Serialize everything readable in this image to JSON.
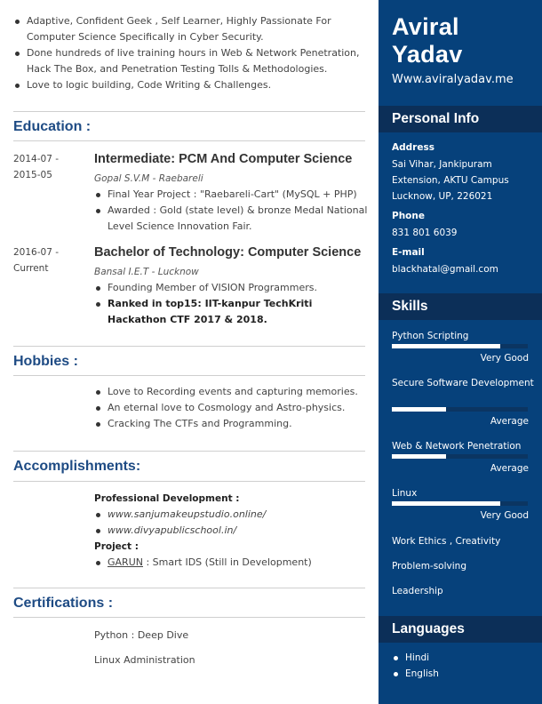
{
  "intro": [
    "Adaptive, Confident Geek , Self Learner, Highly Passionate For Computer Science Specifically in Cyber Security.",
    "Done hundreds of live training hours in Web & Network Penetration, Hack The Box, and Penetration Testing Tolls & Methodologies.",
    "Love to logic building, Code Writing & Challenges."
  ],
  "education": {
    "title": "Education :",
    "entries": [
      {
        "date": "2014-07 - 2015-05",
        "degree": "Intermediate: PCM And Computer Science",
        "institution": "Gopal S.V.M - Raebareli",
        "points": [
          "Final Year Project : \"Raebareli-Cart\" (MySQL + PHP)",
          "Awarded : Gold (state level) & bronze Medal National Level Science Innovation Fair."
        ]
      },
      {
        "date": "2016-07 - Current",
        "degree": "Bachelor of Technology: Computer Science",
        "institution": "Bansal I.E.T - Lucknow",
        "points": [
          "Founding Member of VISION Programmers.",
          "Ranked in top15: IIT-kanpur TechKriti Hackathon CTF 2017 & 2018."
        ]
      }
    ]
  },
  "hobbies": {
    "title": "Hobbies :",
    "items": [
      "Love to Recording events and capturing memories.",
      "An eternal love to Cosmology and Astro-physics.",
      "Cracking The CTFs and Programming."
    ]
  },
  "accomplishments": {
    "title": "Accomplishments:",
    "prof_label": "Professional Development :",
    "prof_items": [
      "www.sanjumakeupstudio.online/",
      "www.divyapublicschool.in/"
    ],
    "project_label": "Project :",
    "project_name": "GARUN",
    "project_desc": " : Smart IDS (Still in Development)"
  },
  "certifications": {
    "title": "Certifications :",
    "items": [
      "Python : Deep Dive",
      "Linux Administration"
    ]
  },
  "profile": {
    "name_first": "Aviral",
    "name_last": "Yadav",
    "website": "Www.aviralyadav.me"
  },
  "personal": {
    "title": "Personal Info",
    "address_label": "Address",
    "address": "Sai Vihar, Jankipuram Extension, AKTU Campus Lucknow, UP, 226021",
    "phone_label": "Phone",
    "phone": "831 801 6039",
    "email_label": "E-mail",
    "email": "blackhatal@gmail.com"
  },
  "skills": {
    "title": "Skills",
    "rated": [
      {
        "name": "Python Scripting",
        "level": "Very Good",
        "fill": 0.8
      },
      {
        "name": "Secure Software Development",
        "level": "Average",
        "fill": 0.4
      },
      {
        "name": "Web & Network Penetration",
        "level": "Average",
        "fill": 0.4
      },
      {
        "name": "Linux",
        "level": "Very Good",
        "fill": 0.8
      }
    ],
    "other": [
      "Work Ethics , Creativity",
      "Problem-solving",
      "Leadership"
    ]
  },
  "languages": {
    "title": "Languages",
    "items": [
      "Hindi",
      "English"
    ]
  },
  "colors": {
    "sidebar": "#06417b",
    "band": "#0c2f58",
    "heading": "#1e4b84"
  }
}
